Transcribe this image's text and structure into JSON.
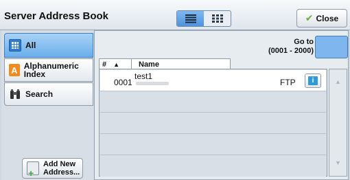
{
  "header": {
    "title": "Server Address Book",
    "close_label": "Close"
  },
  "view_toggle": {
    "active": "list"
  },
  "sidebar": {
    "items": [
      {
        "label": "All",
        "icon": "grid-icon",
        "active": true
      },
      {
        "label": "Alphanumeric Index",
        "icon": "alpha-index-icon",
        "active": false
      },
      {
        "label": "Search",
        "icon": "binoculars-icon",
        "active": false
      }
    ],
    "add_label_line1": "Add New",
    "add_label_line2": "Address..."
  },
  "main": {
    "goto_label_line1": "Go to",
    "goto_label_line2": "(0001 - 2000)",
    "columns": {
      "num": "#",
      "sort_indicator": "▲",
      "name": "Name"
    },
    "rows": [
      {
        "num": "0001",
        "name": "test1",
        "type": "FTP"
      }
    ]
  },
  "colors": {
    "accent": "#6aaeea",
    "goto_field": "#7fb6ee",
    "check": "#6bb03a",
    "info_icon": "#2f9bd6"
  }
}
